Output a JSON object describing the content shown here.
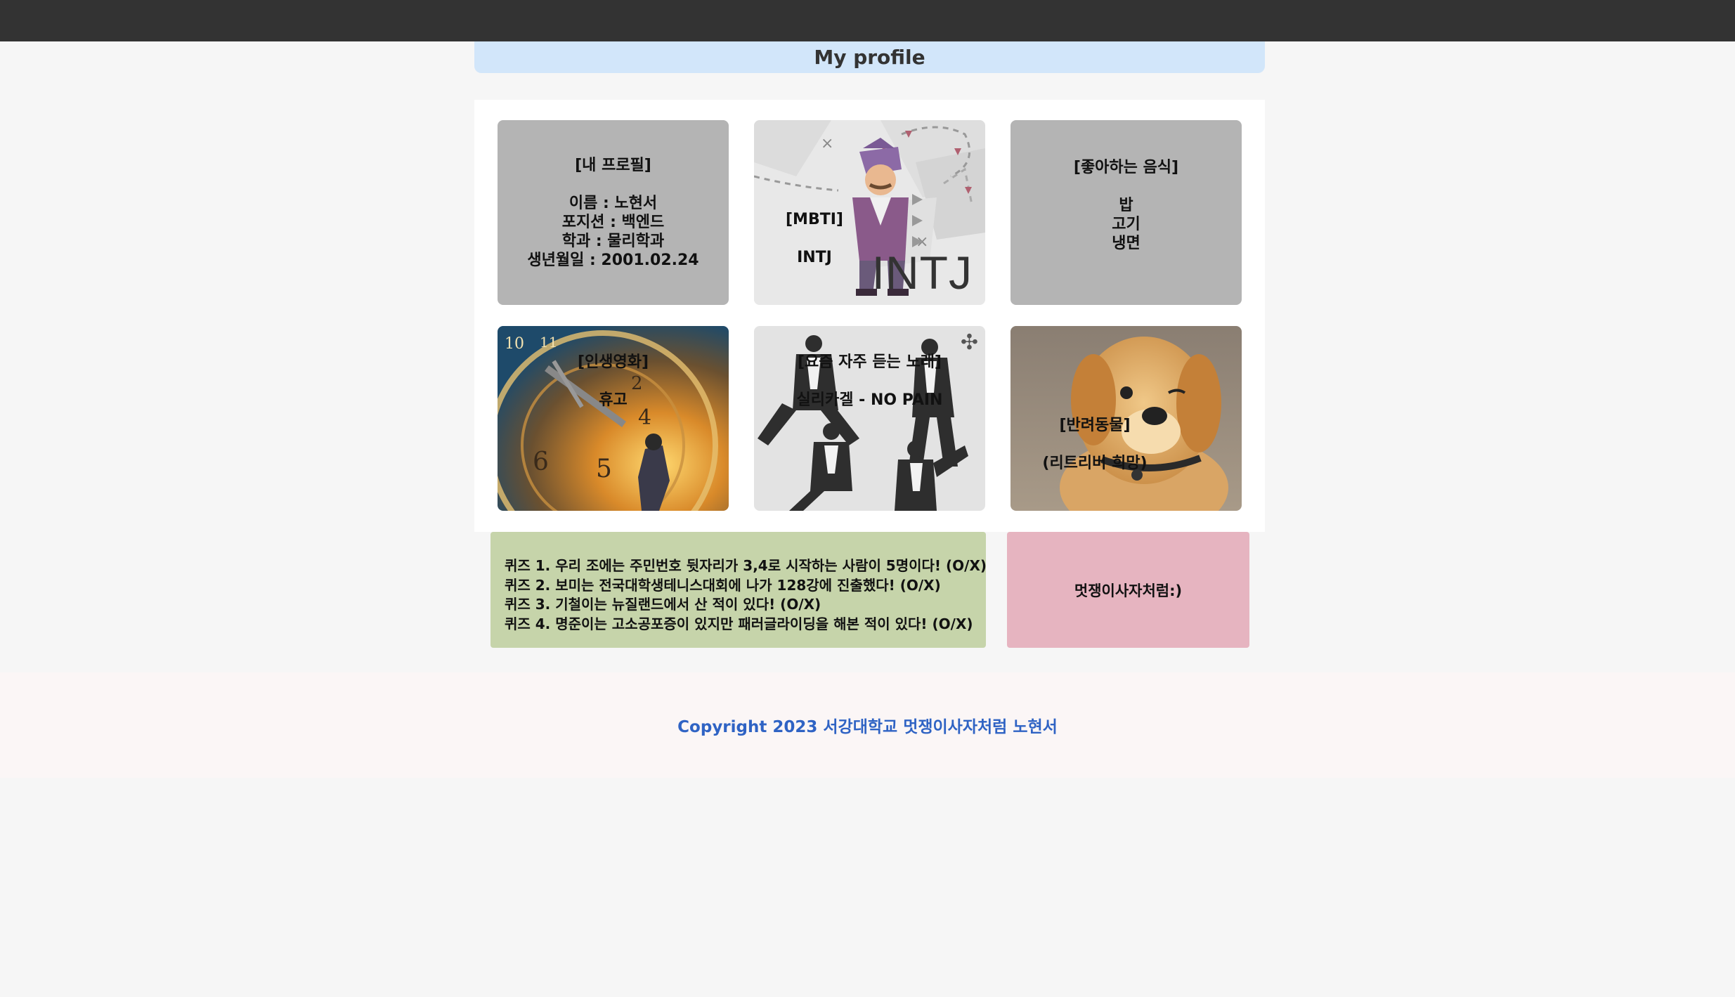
{
  "header": {
    "title": "My profile"
  },
  "cards": {
    "profile": {
      "text": "[내 프로필]\n\n이름 : 노현서\n포지션 : 백엔드\n학과 : 물리학과\n생년월일 : 2001.02.24"
    },
    "mbti": {
      "text": "[MBTI]\n\nINTJ",
      "art_text": "INTJ",
      "icon": "mbti-character-illustration"
    },
    "food": {
      "text": "[좋아하는 음식]\n\n밥\n고기\n냉면"
    },
    "movie": {
      "text": "[인생영화]\n\n휴고",
      "icon": "hugo-clock-poster"
    },
    "song": {
      "text": "[요즘 자주 듣는 노래]\n\n실리카겔 - NO PAIN",
      "icon": "band-jumping-photo",
      "move_icon": "✣"
    },
    "pet": {
      "text": "[반려동물]\n\n(리트리버 희망)",
      "icon": "golden-retriever-puppy-photo"
    }
  },
  "quiz": {
    "items": [
      "퀴즈 1. 우리 조에는 주민번호 뒷자리가 3,4로 시작하는 사람이 5명이다! (O/X)",
      "퀴즈 2. 보미는 전국대학생테니스대회에 나가 128강에 진출했다! (O/X)",
      "퀴즈 3. 기철이는 뉴질랜드에서 산 적이 있다! (O/X)",
      "퀴즈 4. 명준이는 고소공포증이 있지만 패러글라이딩을 해본 적이 있다! (O/X)"
    ]
  },
  "team": {
    "label": "멋쟁이사자처럼:)"
  },
  "footer": {
    "copyright": "Copyright 2023 서강대학교 멋쟁이사자처럼 노현서"
  },
  "colors": {
    "topbar": "#333333",
    "title_bg": "#d2e6fa",
    "card_gray": "#b4b4b4",
    "quiz_bg": "#c6d4aa",
    "team_bg": "#e6b4c0",
    "footer_text": "#2f63c4"
  }
}
